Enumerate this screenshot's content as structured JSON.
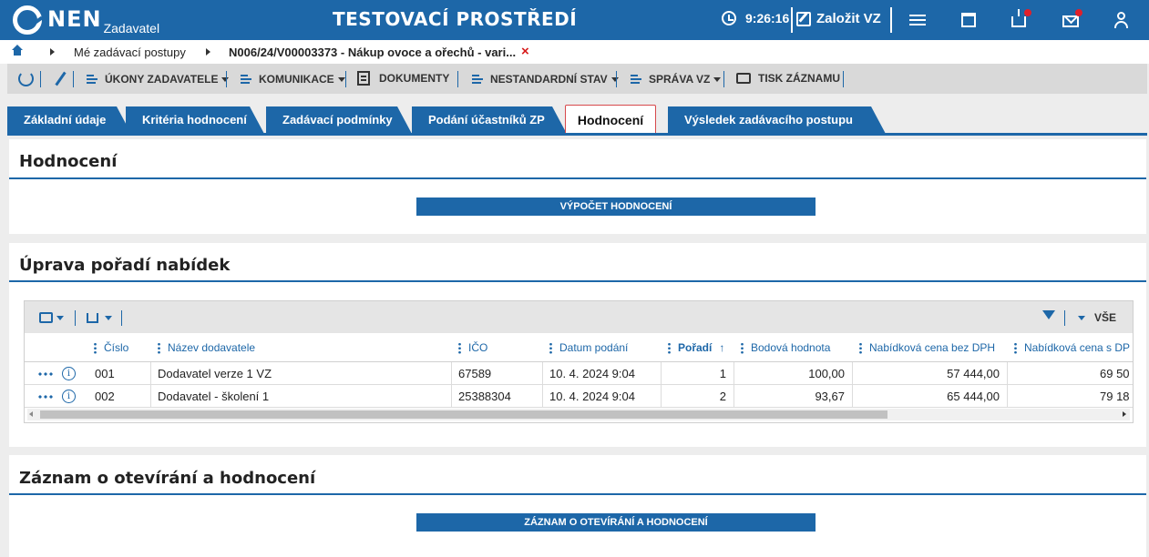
{
  "header": {
    "logo_text": "NEN",
    "logo_sub": "Zadavatel",
    "env_title": "TESTOVACÍ PROSTŘEDÍ",
    "time": "9:26:16",
    "create_label": "Založit VZ",
    "accent": "#1d67a8",
    "notification_color": "#e0202a"
  },
  "breadcrumb": {
    "items": [
      "Mé zadávací postupy",
      "N006/24/V00003373 - Nákup ovoce a ořechů - vari..."
    ],
    "close_icon": "×"
  },
  "toolbar": {
    "ukony": "ÚKONY ZADAVATELE",
    "komunikace": "KOMUNIKACE",
    "dokumenty": "DOKUMENTY",
    "nestandardni": "NESTANDARDNÍ STAV",
    "sprava": "SPRÁVA VZ",
    "tisk": "TISK ZÁZNAMU"
  },
  "tabs": [
    {
      "label": "Základní údaje"
    },
    {
      "label": "Kritéria hodnocení"
    },
    {
      "label": "Zadávací podmínky"
    },
    {
      "label": "Podání účastníků ZP"
    },
    {
      "label": "Hodnocení",
      "active": true
    },
    {
      "label": "Výsledek zadávacího postupu"
    }
  ],
  "panel_hodnoceni": {
    "title": "Hodnocení",
    "button": "VÝPOČET HODNOCENÍ"
  },
  "panel_poradi": {
    "title": "Úprava pořadí nabídek",
    "filter_label": "VŠE",
    "columns": [
      "Číslo",
      "Název dodavatele",
      "IČO",
      "Datum podání",
      "Pořadí",
      "Bodová hodnota",
      "Nabídková cena bez DPH",
      "Nabídková cena s DP"
    ],
    "rows": [
      {
        "cislo": "001",
        "nazev": "Dodavatel verze 1 VZ",
        "ico": "67589",
        "datum": "10. 4. 2024 9:04",
        "poradi": "1",
        "body": "100,00",
        "cena_bez": "57 444,00",
        "cena_s": "69 50"
      },
      {
        "cislo": "002",
        "nazev": "Dodavatel - školení 1",
        "ico": "25388304",
        "datum": "10. 4. 2024 9:04",
        "poradi": "2",
        "body": "93,67",
        "cena_bez": "65 444,00",
        "cena_s": "79 18"
      }
    ]
  },
  "panel_zaznam": {
    "title": "Záznam o otevírání a hodnocení",
    "button": "ZÁZNAM O OTEVÍRÁNÍ A HODNOCENÍ"
  }
}
